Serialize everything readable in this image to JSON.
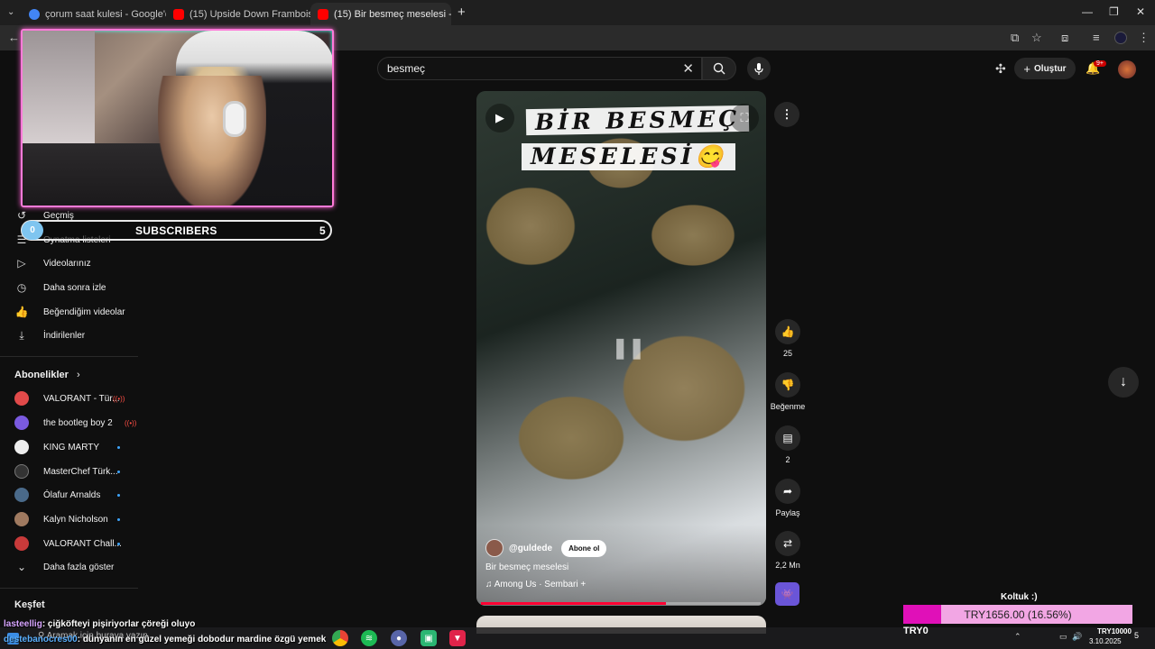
{
  "browser": {
    "tabs": [
      {
        "title": "çorum saat kulesi - Google'da A",
        "favicon_color": "#4285f4"
      },
      {
        "title": "(15) Upside Down Framboise C",
        "favicon_color": "#ff0000"
      },
      {
        "title": "(15) Bir besmeç meselesi - Y",
        "favicon_color": "#ff0000",
        "active": true
      }
    ],
    "new_tab_label": "+"
  },
  "youtube": {
    "search_value": "besmeç",
    "create_label": "Oluştur",
    "notification_badge": "9+"
  },
  "sidebar": {
    "you_items": [
      {
        "label": "Geçmiş",
        "icon": "history-icon"
      },
      {
        "label": "Oynatma listeleri",
        "icon": "playlist-icon"
      },
      {
        "label": "Videolarınız",
        "icon": "video-icon"
      },
      {
        "label": "Daha sonra izle",
        "icon": "clock-icon"
      },
      {
        "label": "Beğendiğim videolar",
        "icon": "thumb-up-icon"
      },
      {
        "label": "İndirilenler",
        "icon": "download-icon"
      }
    ],
    "subscriptions_heading": "Abonelikler",
    "subscriptions": [
      {
        "label": "VALORANT - Tür...",
        "avatar_color": "#e14a4a",
        "live": true
      },
      {
        "label": "the bootleg boy 2",
        "avatar_color": "#7a5ae0",
        "live": true
      },
      {
        "label": "KING MARTY",
        "avatar_color": "#eeeeee",
        "live": false
      },
      {
        "label": "MasterChef Türk...",
        "avatar_color": "#333333",
        "live": false
      },
      {
        "label": "Ólafur Arnalds",
        "avatar_color": "#4a6a8a",
        "live": false
      },
      {
        "label": "Kalyn Nicholson",
        "avatar_color": "#a07a60",
        "live": false
      },
      {
        "label": "VALORANT Chall...",
        "avatar_color": "#c83a3a",
        "live": false
      }
    ],
    "show_more_label": "Daha fazla göster",
    "explore_heading": "Keşfet"
  },
  "overlay": {
    "subscribers_left": "0",
    "subscribers_label": "SUBSCRIBERS",
    "subscribers_right": "5",
    "chat": [
      {
        "user": "lasteellig",
        "message": ": çiğköfteyi pişiriyorlar çöreği oluyo"
      },
      {
        "user": "destebanocres00",
        "message": ": dünyanın en güzel yemeği dobodur mardine özgü yemek"
      }
    ],
    "goal_title": "Koltuk :)",
    "goal_text": "TRY1656.00 (16.56%)",
    "goal_progress": 0.1656,
    "goal_start": "TRY0",
    "goal_end": "TRY10000"
  },
  "short": {
    "title_line1": "BİR BESMEÇ",
    "title_line2": "MESELESİ😋",
    "channel_handle": "@guldede",
    "subscribe_label": "Abone ol",
    "caption": "Bir besmeç meselesi",
    "music": "Among Us · Sembari +",
    "progress": 0.66,
    "likes": "25",
    "dislike_label": "Beğenme",
    "comments": "2",
    "share_label": "Paylaş",
    "remix_count": "2,2 Mn"
  },
  "taskbar": {
    "search_placeholder": "Aramak için buraya yazın",
    "date": "3.10.2025",
    "notification_count": "5"
  }
}
